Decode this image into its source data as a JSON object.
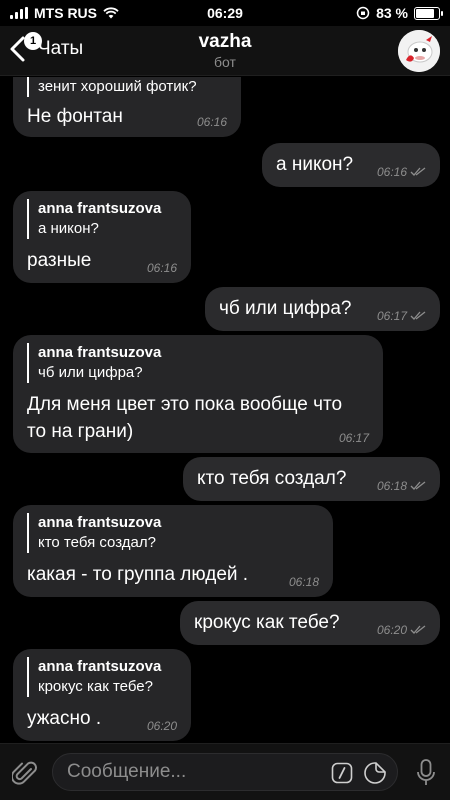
{
  "status_bar": {
    "carrier": "MTS RUS",
    "time": "06:29",
    "battery": "83 %",
    "battery_level": 0.83
  },
  "header": {
    "back_label": "Чаты",
    "back_badge": "1",
    "title": "vazha",
    "subtitle": "бот"
  },
  "messages": [
    {
      "dir": "in",
      "reply_text": "зенит хороший фотик?",
      "text": "Не фонтан",
      "time": "06:16"
    },
    {
      "dir": "out",
      "text": "а никон?",
      "time": "06:16"
    },
    {
      "dir": "in",
      "reply_name": "anna frantsuzova",
      "reply_text": "а никон?",
      "text": "разные",
      "time": "06:16"
    },
    {
      "dir": "out",
      "text": "чб или цифра?",
      "time": "06:17"
    },
    {
      "dir": "in",
      "reply_name": "anna frantsuzova",
      "reply_text": "чб или цифра?",
      "text_line1": "Для меня цвет это пока вообще что",
      "text_line2": "то на грани)",
      "time": "06:17"
    },
    {
      "dir": "out",
      "text": "кто тебя создал?",
      "time": "06:18"
    },
    {
      "dir": "in",
      "reply_name": "anna frantsuzova",
      "reply_text": "кто тебя создал?",
      "text": "какая - то группа людей .",
      "time": "06:18"
    },
    {
      "dir": "out",
      "text": "крокус как тебе?",
      "time": "06:20"
    },
    {
      "dir": "in",
      "reply_name": "anna frantsuzova",
      "reply_text": "крокус как тебе?",
      "text": "ужасно .",
      "time": "06:20"
    }
  ],
  "input": {
    "placeholder": "Сообщение..."
  },
  "icons": {
    "attach": "paperclip-icon",
    "commands": "slash-command-icon",
    "sticker": "sticker-icon",
    "mic": "microphone-icon"
  }
}
